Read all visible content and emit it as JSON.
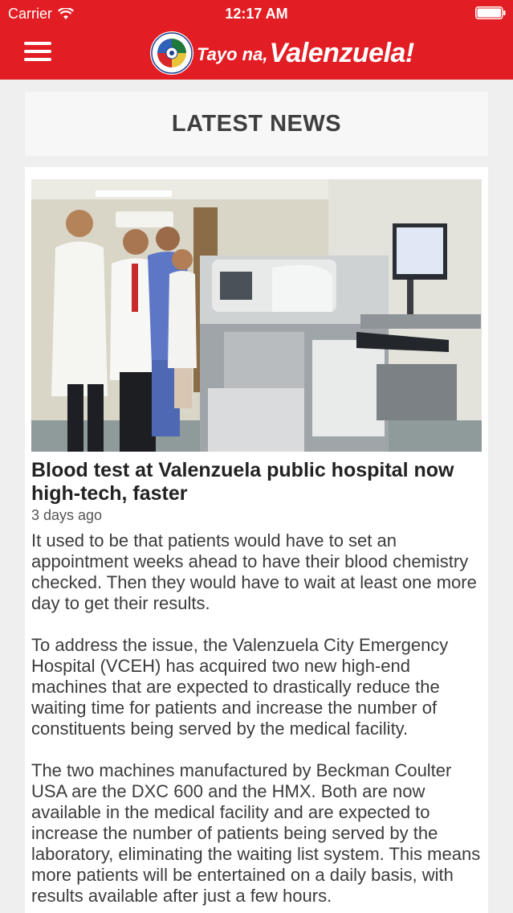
{
  "status_bar": {
    "carrier": "Carrier",
    "time": "12:17 AM"
  },
  "header": {
    "brand_prefix": "Tayo na,",
    "brand_name": "Valenzuela!",
    "accent_color": "#e21d23"
  },
  "section": {
    "title": "LATEST NEWS"
  },
  "article": {
    "title": "Blood test at Valenzuela public hospital now high-tech, faster",
    "date": "3 days ago",
    "paragraphs": [
      "It used to be that patients would have to set an appointment weeks ahead to have their blood chemistry checked. Then they would have to wait at least one more day to get their results.",
      "To address the issue, the Valenzuela City Emergency Hospital (VCEH) has acquired two new high-end machines that are expected to drastically reduce the waiting time for patients and increase the number of constituents being served by the medical facility.",
      "The two machines manufactured by Beckman Coulter USA are the DXC 600 and the HMX. Both are now available in the medical facility and are expected to increase the number of patients being served by the laboratory, eliminating the waiting list system. This means more patients will be entertained on a daily basis, with results available after just a few hours."
    ]
  },
  "icons": {
    "menu": "hamburger-menu-icon",
    "wifi": "wifi-icon",
    "battery": "battery-icon",
    "seal": "city-seal-icon"
  }
}
